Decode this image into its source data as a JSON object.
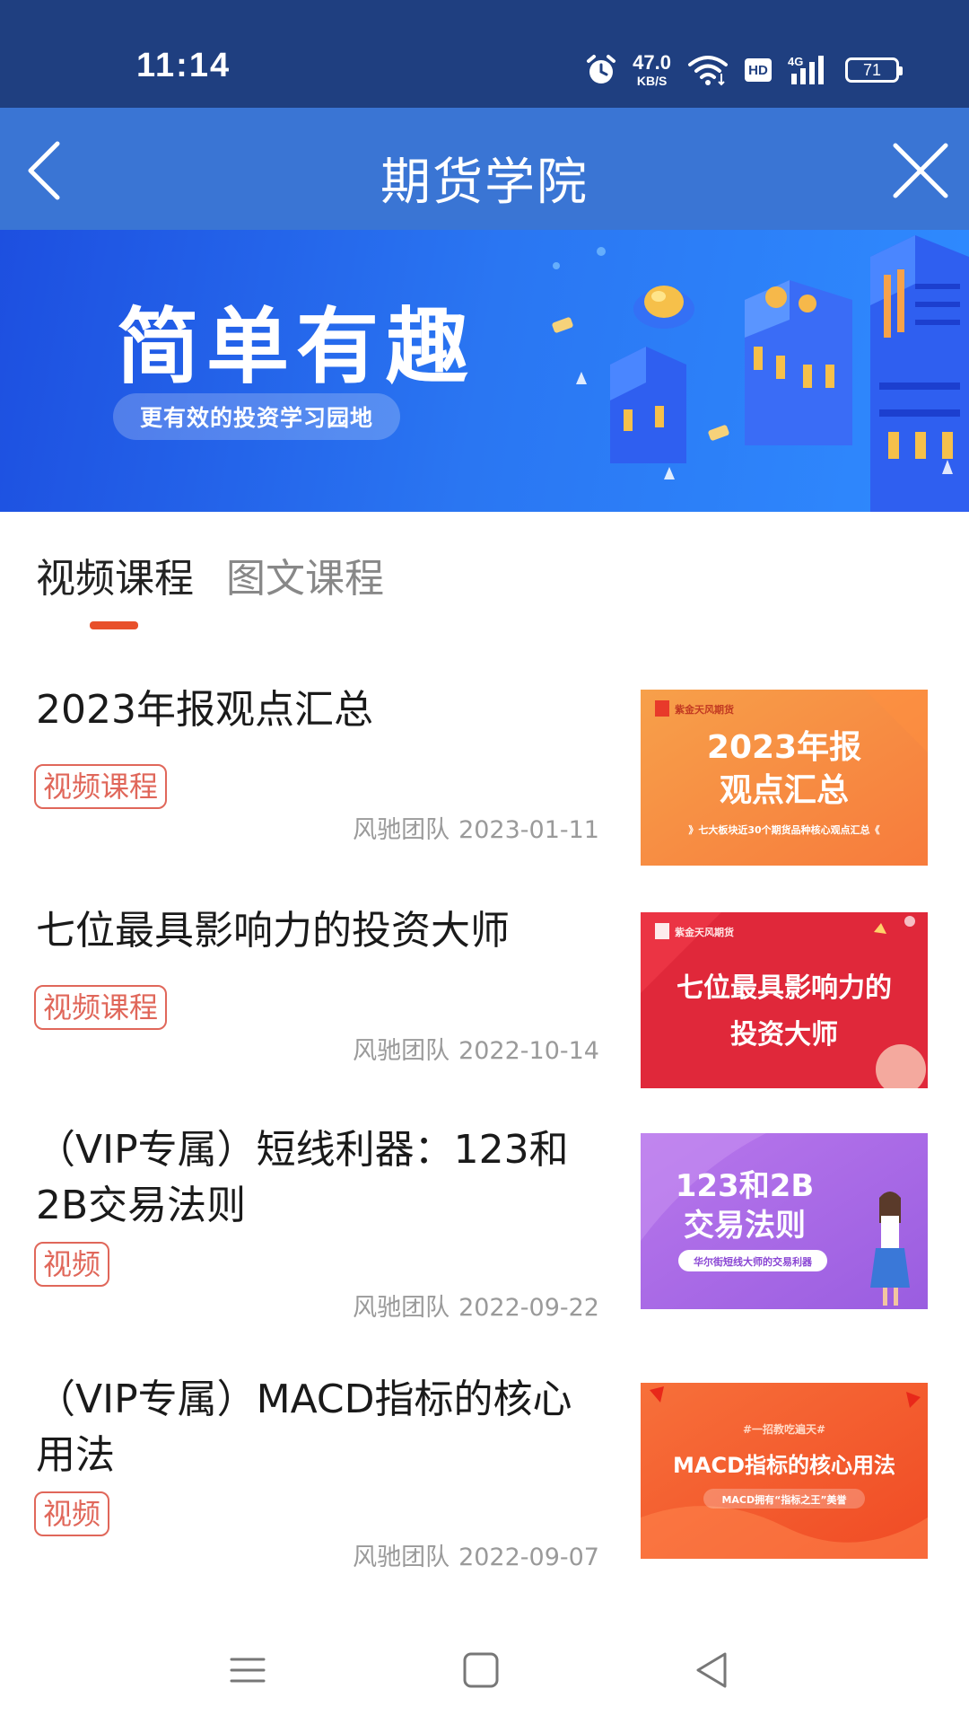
{
  "status_bar": {
    "time": "11:14",
    "net_speed_value": "47.0",
    "net_speed_unit": "KB/S",
    "hd_label": "HD",
    "signal_label": "4G",
    "battery": "71",
    "icons": [
      "alarm-icon",
      "wifi-icon",
      "hd-icon",
      "signal-icon",
      "battery-icon"
    ]
  },
  "header": {
    "title": "期货学院",
    "back_icon": "chevron-left-icon",
    "close_icon": "close-icon"
  },
  "banner": {
    "title": "简单有趣",
    "subtitle": "更有效的投资学习园地"
  },
  "tabs": [
    {
      "label": "视频课程",
      "active": true
    },
    {
      "label": "图文课程",
      "active": false
    }
  ],
  "courses": [
    {
      "title": "2023年报观点汇总",
      "tag": "视频课程",
      "author": "风驰团队",
      "date": "2023-01-11",
      "thumb": {
        "brand": "紫金天风期货",
        "line1": "2023年报",
        "line2": "观点汇总",
        "caption": "》七大板块近30个期货品种核心观点汇总《",
        "bg_from": "#f7a04a",
        "bg_to": "#f77b3c"
      }
    },
    {
      "title": "七位最具影响力的投资大师",
      "tag": "视频课程",
      "author": "风驰团队",
      "date": "2022-10-14",
      "thumb": {
        "brand": "紫金天风期货",
        "line1": "七位最具影响力的",
        "line2": "投资大师",
        "bg_from": "#e8283a",
        "bg_to": "#d81e30"
      }
    },
    {
      "title": "（VIP专属）短线利器：123和2B交易法则",
      "tag": "视频",
      "author": "风驰团队",
      "date": "2022-09-22",
      "thumb": {
        "line1": "123和2B",
        "line2": "交易法则",
        "caption": "华尔街短线大师的交易利器",
        "bg_from": "#b06ee6",
        "bg_to": "#9a5de0"
      }
    },
    {
      "title": "（VIP专属）MACD指标的核心用法",
      "tag": "视频",
      "author": "风驰团队",
      "date": "2022-09-07",
      "thumb": {
        "line0": "#一招教吃遍天#",
        "line1": "MACD指标的核心用法",
        "caption": "MACD拥有“指标之王”美誉",
        "bg_from": "#f76a3a",
        "bg_to": "#f04a24"
      }
    }
  ],
  "nav_bar": {
    "icons": [
      "menu-icon",
      "home-icon",
      "back-triangle-icon"
    ]
  },
  "colors": {
    "status_bar": "#1f3f80",
    "header": "#3a75d4",
    "accent": "#e8502a",
    "tag": "#e0675a"
  }
}
